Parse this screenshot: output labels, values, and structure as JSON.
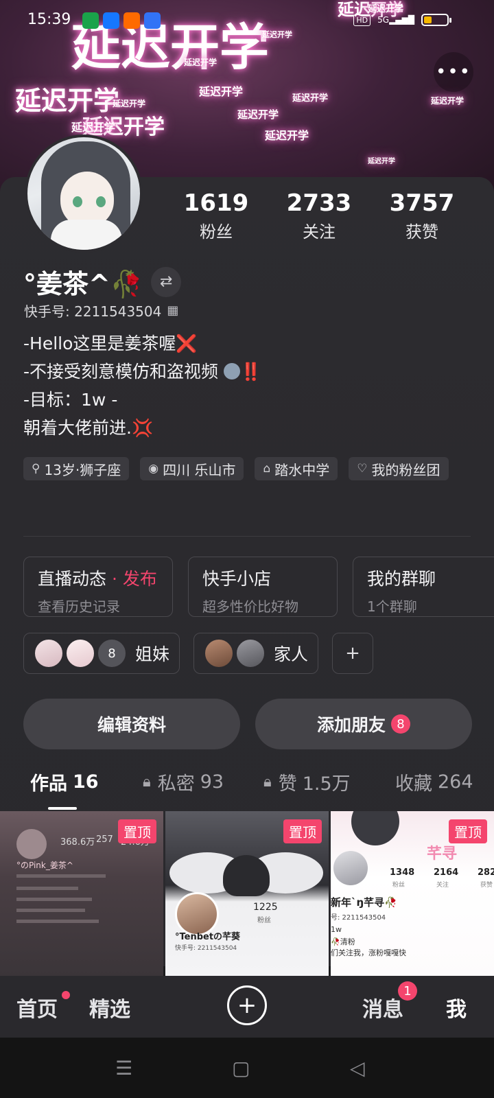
{
  "status_bar": {
    "time": "15:39",
    "hd": "HD",
    "signal": "5G",
    "battery_level": 0.35,
    "battery_color": "#f5b800"
  },
  "banner": {
    "big_text": "延迟开学",
    "small_text": "延迟开学",
    "glow_color": "#ff7ad0"
  },
  "profile": {
    "stats": [
      {
        "value": "1619",
        "label": "粉丝"
      },
      {
        "value": "2733",
        "label": "关注"
      },
      {
        "value": "3757",
        "label": "获赞"
      }
    ],
    "name": "°姜茶^🥀",
    "kuaishou_id": "快手号: 2211543504",
    "bio": [
      "-Hello这里是姜茶喔",
      "-不接受刻意模仿和盗视频",
      "-目标：1w -",
      "朝着大佬前进."
    ],
    "bio_emoji": {
      "line1": "❌",
      "line2": "‼️",
      "line4": "💢"
    },
    "tags": [
      {
        "icon": "search-icon",
        "label": "13岁·狮子座"
      },
      {
        "icon": "location-pin-icon",
        "label": "四川 乐山市"
      },
      {
        "icon": "graduation-cap-icon",
        "label": "踏水中学"
      },
      {
        "icon": "fan-club-icon",
        "label": "我的粉丝团"
      }
    ]
  },
  "features": [
    {
      "title": "直播动态",
      "title_suffix": " · 发布",
      "subtitle": "查看历史记录"
    },
    {
      "title": "快手小店",
      "subtitle": "超多性价比好物"
    },
    {
      "title": "我的群聊",
      "subtitle": "1个群聊"
    }
  ],
  "groups": [
    {
      "label": "姐妹",
      "extra_count": "8"
    },
    {
      "label": "家人"
    }
  ],
  "group_add": "+",
  "actions": {
    "edit": "编辑资料",
    "add_friend": "添加朋友",
    "add_friend_badge": "8"
  },
  "tabs": [
    {
      "label": "作品",
      "count": "16",
      "active": true
    },
    {
      "label": "私密",
      "count": "93",
      "locked": true
    },
    {
      "label": "赞",
      "count": "1.5万",
      "locked": true
    },
    {
      "label": "收藏",
      "count": "264"
    }
  ],
  "videos": [
    {
      "pinned_label": "置顶",
      "stats": [
        "368.6万",
        "257",
        "24.6万"
      ],
      "name": "°のPink_姜茶^"
    },
    {
      "pinned_label": "置顶",
      "fans": "1225",
      "fans_label": "粉丝",
      "name": "°Tenbetの芊葵",
      "id_text": "快手号: 2211543504"
    },
    {
      "pinned_label": "置顶",
      "stats": [
        "1348",
        "2164",
        "282"
      ],
      "stat_labels": [
        "粉丝",
        "关注",
        "获赞"
      ],
      "name": "新年`ŋ芊寻🥀",
      "id_text": "号: 2211543504",
      "lines": [
        "1w",
        "🥀清粉",
        "们关注我，涨粉嘎嘎快"
      ],
      "overlay_text": "芊寻"
    }
  ],
  "bottom_nav": {
    "home": "首页",
    "featured": "精选",
    "create": "+",
    "messages": "消息",
    "messages_badge": "1",
    "me": "我"
  },
  "accent_color": "#f4456d"
}
